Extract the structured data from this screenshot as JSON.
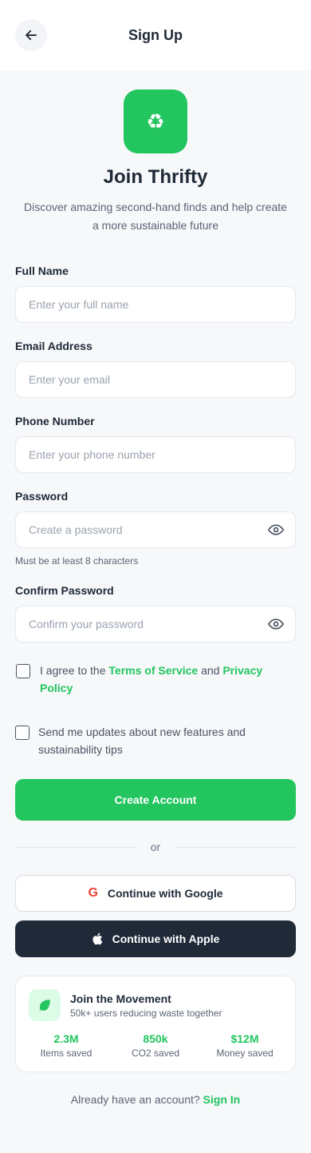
{
  "header": {
    "title": "Sign Up",
    "back_icon": "arrow-left-icon"
  },
  "hero": {
    "logo_icon": "recycle-icon",
    "title": "Join Thrifty",
    "subtitle": "Discover amazing second-hand finds and help create a more sustainable future"
  },
  "form": {
    "full_name": {
      "label": "Full Name",
      "placeholder": "Enter your full name",
      "value": ""
    },
    "email": {
      "label": "Email Address",
      "placeholder": "Enter your email",
      "value": ""
    },
    "phone": {
      "label": "Phone Number",
      "placeholder": "Enter your phone number",
      "value": ""
    },
    "password": {
      "label": "Password",
      "placeholder": "Create a password",
      "value": "",
      "hint": "Must be at least 8 characters"
    },
    "confirm_password": {
      "label": "Confirm Password",
      "placeholder": "Confirm your password",
      "value": ""
    },
    "terms": {
      "prefix": "I agree to the ",
      "terms_link": "Terms of Service",
      "middle": " and ",
      "privacy_link": "Privacy Policy",
      "checked": false
    },
    "updates": {
      "text": "Send me updates about new features and sustainability tips",
      "checked": false
    },
    "submit_label": "Create Account"
  },
  "divider": {
    "text": "or"
  },
  "social": {
    "google_label": "Continue with Google",
    "apple_label": "Continue with Apple"
  },
  "movement": {
    "title": "Join the Movement",
    "subtitle": "50k+ users reducing waste together",
    "stats": [
      {
        "value": "2.3M",
        "label": "Items saved"
      },
      {
        "value": "850k",
        "label": "CO2 saved"
      },
      {
        "value": "$12M",
        "label": "Money saved"
      }
    ]
  },
  "footer": {
    "prompt": "Already have an account? ",
    "sign_in_link": "Sign In"
  },
  "colors": {
    "accent": "#22c55e",
    "dark_button": "#1f2937",
    "background": "#f6f8fa"
  }
}
